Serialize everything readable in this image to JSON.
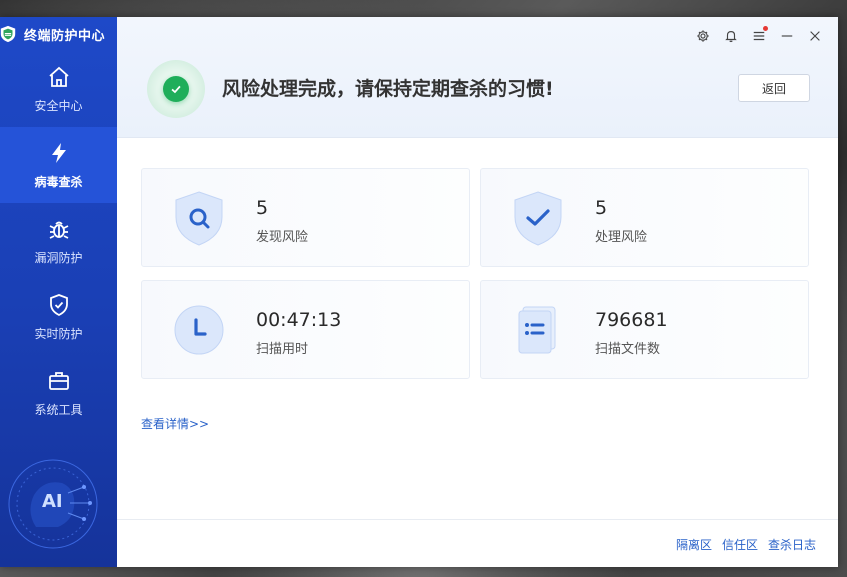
{
  "app": {
    "title": "终端防护中心"
  },
  "sidebar": {
    "items": [
      {
        "label": "安全中心",
        "icon": "home-icon"
      },
      {
        "label": "病毒查杀",
        "icon": "lightning-icon",
        "active": true
      },
      {
        "label": "漏洞防护",
        "icon": "bug-icon"
      },
      {
        "label": "实时防护",
        "icon": "shield-check-icon"
      },
      {
        "label": "系统工具",
        "icon": "toolbox-icon"
      }
    ],
    "ai_label": "AI"
  },
  "header": {
    "status_text": "风险处理完成，请保持定期查杀的习惯!",
    "back_label": "返回"
  },
  "stats": {
    "found": {
      "value": "5",
      "label": "发现风险"
    },
    "handled": {
      "value": "5",
      "label": "处理风险"
    },
    "time": {
      "value": "00:47:13",
      "label": "扫描用时"
    },
    "files": {
      "value": "796681",
      "label": "扫描文件数"
    }
  },
  "details_link": "查看详情>>",
  "footer": {
    "links": [
      "隔离区",
      "信任区",
      "查杀日志"
    ]
  },
  "colors": {
    "accent": "#1e49c8",
    "success": "#1fae5a",
    "link": "#2a62c9"
  }
}
